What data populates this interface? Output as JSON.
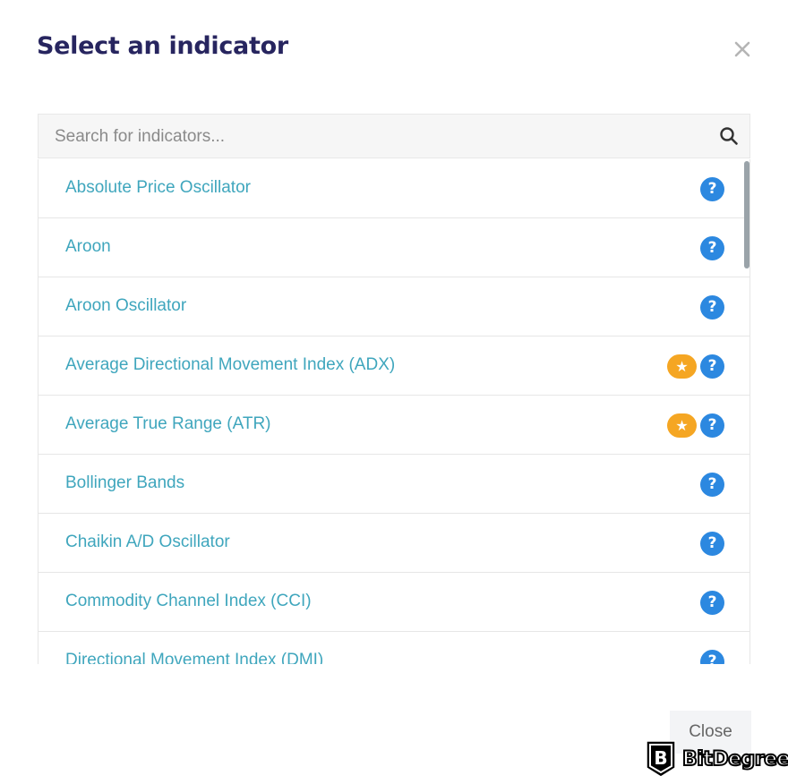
{
  "dialog": {
    "title": "Select an indicator",
    "close_icon": "close-icon"
  },
  "search": {
    "placeholder": "Search for indicators...",
    "value": "",
    "icon": "search-icon"
  },
  "indicators": [
    {
      "label": "Absolute Price Oscillator",
      "favorite": false,
      "help": true
    },
    {
      "label": "Aroon",
      "favorite": false,
      "help": true
    },
    {
      "label": "Aroon Oscillator",
      "favorite": false,
      "help": true
    },
    {
      "label": "Average Directional Movement Index (ADX)",
      "favorite": true,
      "help": true
    },
    {
      "label": "Average True Range (ATR)",
      "favorite": true,
      "help": true
    },
    {
      "label": "Bollinger Bands",
      "favorite": false,
      "help": true
    },
    {
      "label": "Chaikin A/D Oscillator",
      "favorite": false,
      "help": true
    },
    {
      "label": "Commodity Channel Index (CCI)",
      "favorite": false,
      "help": true
    },
    {
      "label": "Directional Movement Index (DMI)",
      "favorite": false,
      "help": true
    }
  ],
  "icons": {
    "help_glyph": "?",
    "star_glyph": "★"
  },
  "footer": {
    "close_label": "Close"
  },
  "watermark": {
    "text": "BitDegree",
    "logo_letter": "B"
  },
  "colors": {
    "title": "#27255f",
    "item_text": "#3fa6bd",
    "help_badge": "#2c88e0",
    "star_badge": "#f5a623"
  }
}
